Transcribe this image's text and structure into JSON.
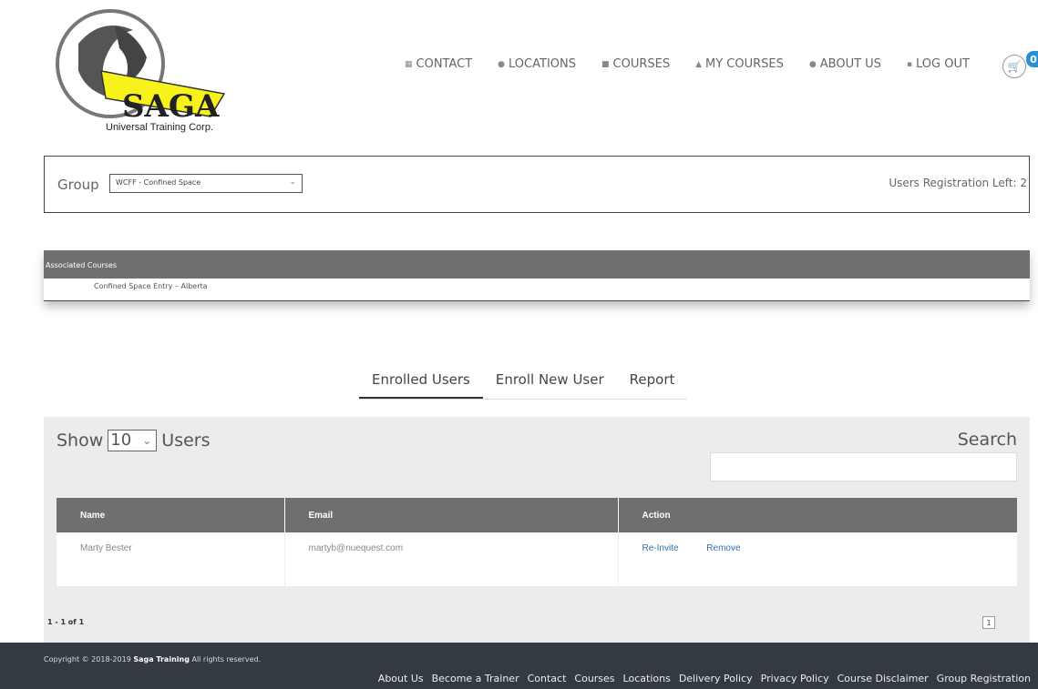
{
  "brand": {
    "name": "SAGA",
    "caption": "Universal Training Corp."
  },
  "nav": [
    {
      "label": "CONTACT",
      "icon": "building-icon"
    },
    {
      "label": "LOCATIONS",
      "icon": "map-pin-icon"
    },
    {
      "label": "COURSES",
      "icon": "book-icon"
    },
    {
      "label": "MY COURSES",
      "icon": "user-icon"
    },
    {
      "label": "ABOUT US",
      "icon": "info-icon"
    },
    {
      "label": "LOG OUT",
      "icon": "logout-icon"
    }
  ],
  "cart": {
    "count": "0",
    "icon": "cart-icon"
  },
  "group": {
    "label": "Group",
    "selected": "WCFF - Confined Space",
    "users_left": "Users Registration Left: 2"
  },
  "associated": {
    "header": "Associated Courses",
    "courses": [
      "Confined Space Entry – Alberta"
    ]
  },
  "tabs": [
    "Enrolled Users",
    "Enroll New User",
    "Report"
  ],
  "users_panel": {
    "show_label": "Show",
    "show_value": "10",
    "users_label": "Users",
    "search_label": "Search",
    "columns": [
      "Name",
      "Email",
      "Action"
    ],
    "rows": [
      {
        "name": "Marty Bester",
        "email": "martyb@nuequest.com",
        "actions": [
          "Re-Invite",
          "Remove"
        ]
      }
    ],
    "pager_info": "1 - 1 of 1",
    "page": "1"
  },
  "footer": {
    "copyright_prefix": "Copyright © 2018-2019",
    "copyright_brand": "Saga Training",
    "copyright_suffix": "All rights reserved.",
    "links": [
      "About Us",
      "Become a Trainer",
      "Contact",
      "Courses",
      "Locations",
      "Delivery Policy",
      "Privacy Policy",
      "Course Disclaimer",
      "Group Registration"
    ]
  },
  "colors": {
    "logo_yellow": "#f6f21a",
    "header_gray": "#707070",
    "footer_bg": "#333a40",
    "link_blue": "#2e6fae",
    "badge_blue": "#2b8fd6"
  }
}
